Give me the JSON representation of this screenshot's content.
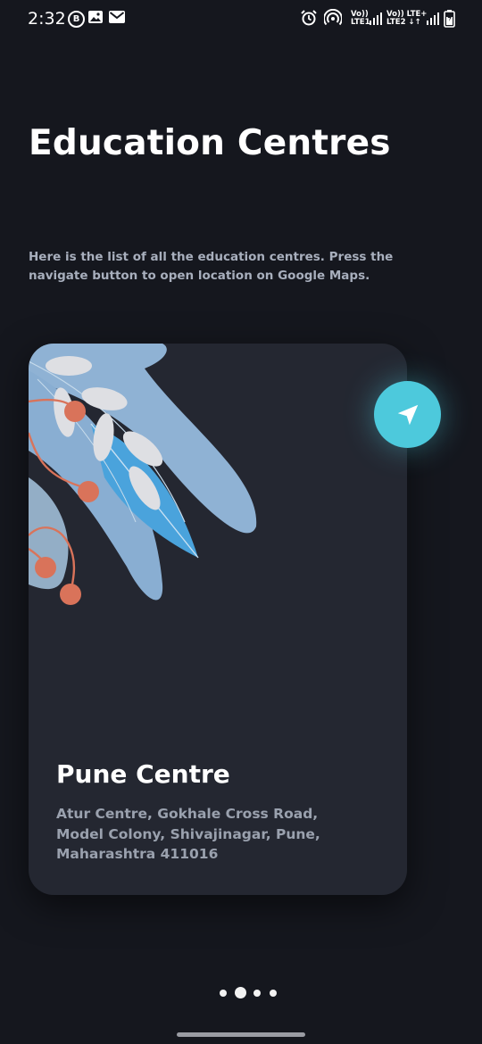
{
  "status_bar": {
    "time": "2:32",
    "b_badge": "B",
    "sim1_label_top": "Vo))",
    "sim1_label_bottom": "LTE1",
    "sim2_label_top": "Vo)) LTE+",
    "sim2_label_bottom": "LTE2 ↓↑",
    "icons": [
      "b-badge-icon",
      "image-icon",
      "mail-icon",
      "alarm-icon",
      "hotspot-icon",
      "signal-icon",
      "signal-icon",
      "battery-icon"
    ]
  },
  "page": {
    "title": "Education Centres",
    "subtitle": "Here is the list of all the education centres. Press the navigate button to open location on Google Maps."
  },
  "card": {
    "name": "Pune Centre",
    "address": "Atur Centre, Gokhale Cross Road, Model Colony, Shivajinagar, Pune, Maharashtra 411016",
    "navigate_icon": "navigation-arrow-icon"
  },
  "pager": {
    "count": 4,
    "active_index": 1
  },
  "colors": {
    "background": "#15171e",
    "card": "#242731",
    "accent": "#4dc9dc",
    "berry": "#d9735a",
    "leaf": "#8eb3d6"
  }
}
